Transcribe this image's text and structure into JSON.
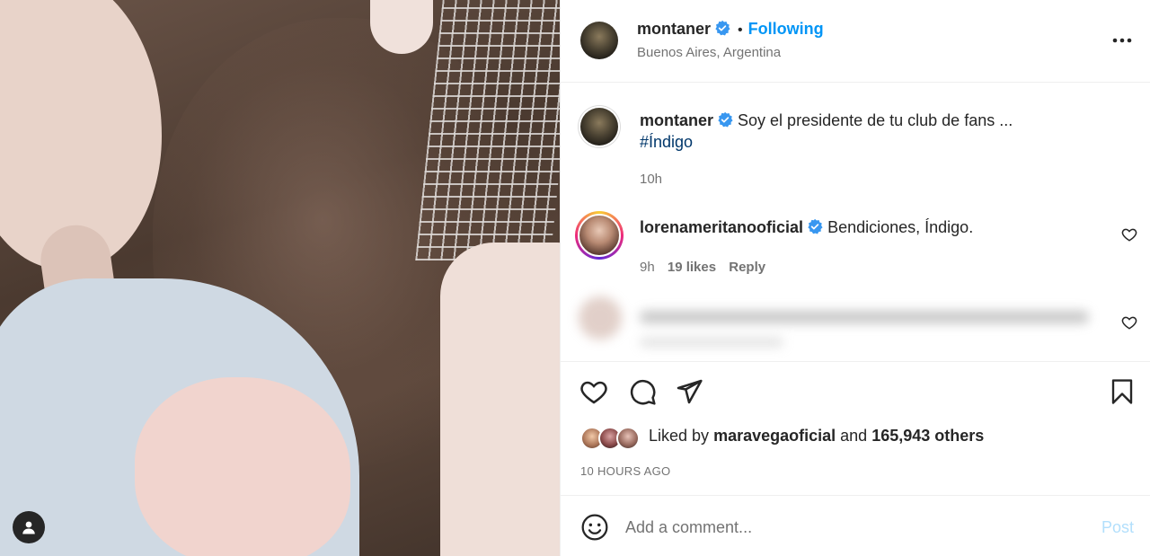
{
  "header": {
    "username": "montaner",
    "verified": true,
    "separator": "•",
    "follow_status": "Following",
    "location": "Buenos Aires, Argentina"
  },
  "caption": {
    "username": "montaner",
    "text": "Soy el presidente de tu club de fans ...",
    "hashtag": "#Índigo",
    "time": "10h"
  },
  "comments": [
    {
      "username": "lorenameritanooficial",
      "text": "Bendiciones, Índigo.",
      "time": "9h",
      "likes": "19 likes",
      "reply_label": "Reply"
    }
  ],
  "likes": {
    "prefix": "Liked by",
    "user": "maravegaoficial",
    "connector": "and",
    "others": "165,943 others"
  },
  "post_time": "10 HOURS AGO",
  "composer": {
    "placeholder": "Add a comment...",
    "post_label": "Post"
  },
  "icons": {
    "more": "more-options-icon",
    "like": "heart-icon",
    "comment": "comment-icon",
    "share": "paper-plane-icon",
    "save": "bookmark-icon",
    "emoji": "emoji-icon",
    "user": "user-tag-icon"
  },
  "colors": {
    "accent": "#0095f6",
    "verified": "#3897f0",
    "post_disabled": "#b2dffc",
    "hashtag": "#00376b"
  }
}
